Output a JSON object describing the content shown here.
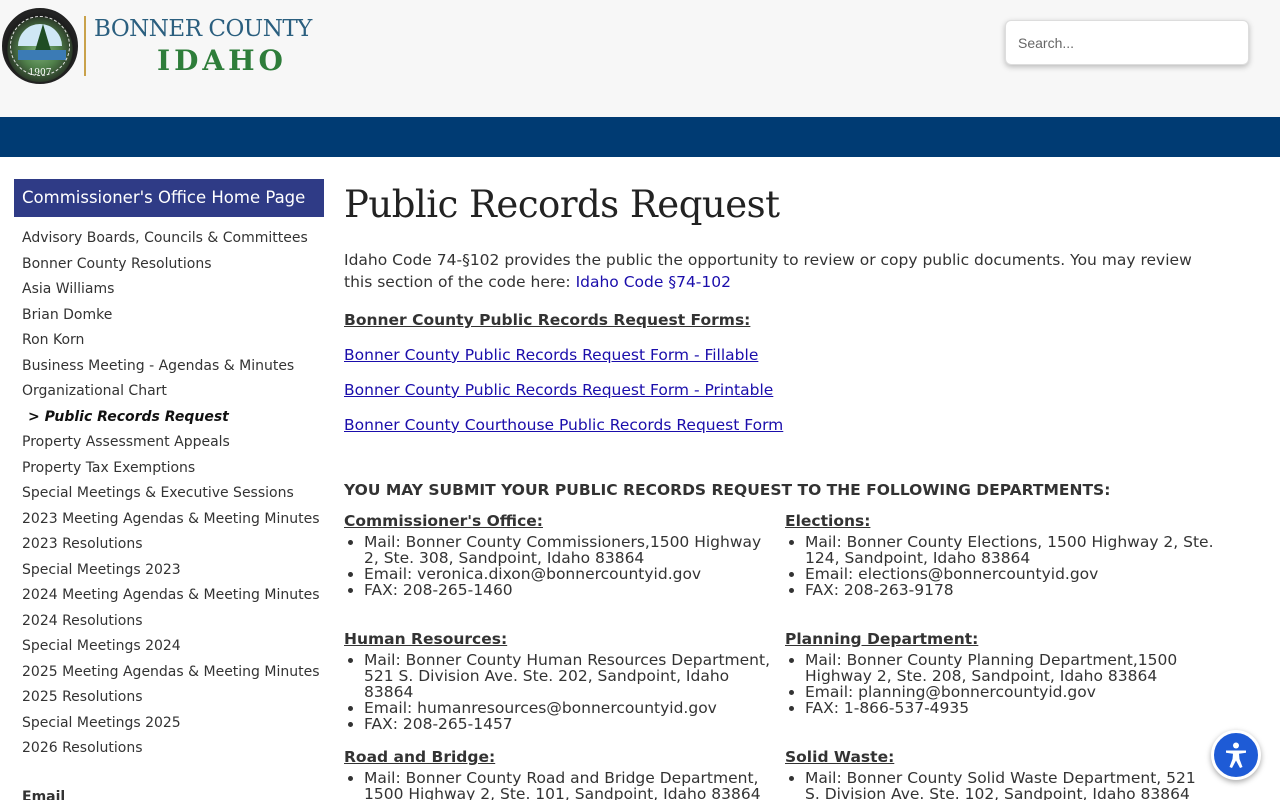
{
  "header": {
    "logo_line1": "BONNER COUNTY",
    "logo_line2": "IDAHO",
    "seal_year": "1907",
    "search_placeholder": "Search..."
  },
  "sidebar": {
    "home_label": "Commissioner's Office Home Page",
    "items": [
      {
        "label": "Advisory Boards, Councils & Committees"
      },
      {
        "label": "Bonner County Resolutions"
      },
      {
        "label": "Asia Williams"
      },
      {
        "label": "Brian Domke"
      },
      {
        "label": "Ron Korn"
      },
      {
        "label": "Business Meeting - Agendas & Minutes"
      },
      {
        "label": "Organizational Chart"
      },
      {
        "label": "> Public Records Request"
      },
      {
        "label": "Property Assessment Appeals"
      },
      {
        "label": "Property Tax Exemptions"
      },
      {
        "label": "Special Meetings & Executive Sessions"
      },
      {
        "label": "2023 Meeting Agendas & Meeting Minutes"
      },
      {
        "label": "2023 Resolutions"
      },
      {
        "label": "Special Meetings 2023"
      },
      {
        "label": "2024 Meeting Agendas & Meeting Minutes"
      },
      {
        "label": "2024 Resolutions"
      },
      {
        "label": "Special Meetings 2024"
      },
      {
        "label": "2025 Meeting Agendas & Meeting Minutes"
      },
      {
        "label": "2025 Resolutions"
      },
      {
        "label": "Special Meetings 2025"
      },
      {
        "label": "2026 Resolutions"
      }
    ],
    "email_heading": "Email"
  },
  "main": {
    "title": "Public Records Request",
    "intro_text": "Idaho Code 74-§102 provides the public the opportunity to review or copy public documents.  You may review this section of the code here:  ",
    "intro_link": "Idaho Code §74-102",
    "forms_heading": "Bonner County Public Records Request Forms:",
    "form_links": [
      "Bonner County Public Records Request Form - Fillable",
      "Bonner County Public Records Request Form - Printable",
      "Bonner County Courthouse Public Records Request Form"
    ],
    "departments_heading": "YOU MAY SUBMIT YOUR PUBLIC RECORDS REQUEST TO THE FOLLOWING DEPARTMENTS:",
    "departments": [
      {
        "name": "Commissioner's Office:",
        "mail": "Mail:  Bonner County Commissioners,1500 Highway 2, Ste. 308, Sandpoint, Idaho 83864",
        "email": "Email:  veronica.dixon@bonnercountyid.gov",
        "fax": "FAX:  208-265-1460"
      },
      {
        "name": "Elections:",
        "mail": "Mail:  Bonner County Elections, 1500 Highway 2, Ste. 124, Sandpoint, Idaho 83864",
        "email": "Email:  elections@bonnercountyid.gov",
        "fax": "FAX:  208-263-9178"
      },
      {
        "name": "Human Resources:",
        "mail": "Mail:  Bonner County Human Resources Department, 521 S. Division Ave. Ste. 202, Sandpoint, Idaho 83864",
        "email": "Email:  humanresources@bonnercountyid.gov",
        "fax": "FAX:  208-265-1457"
      },
      {
        "name": "Planning Department:",
        "mail": "Mail:  Bonner County Planning Department,1500 Highway 2, Ste. 208, Sandpoint, Idaho 83864",
        "email": "Email:  planning@bonnercountyid.gov",
        "fax": "FAX:  1-866-537-4935"
      },
      {
        "name": "Road and Bridge:",
        "mail": "Mail:  Bonner County Road and Bridge Department, 1500 Highway 2, Ste. 101, Sandpoint, Idaho 83864"
      },
      {
        "name": "Solid Waste:",
        "mail": "Mail:  Bonner County Solid Waste Department, 521 S. Division Ave. Ste. 102, Sandpoint, Idaho 83864"
      }
    ]
  },
  "colors": {
    "navbar": "#003b73",
    "sidebar_home_bg": "#2f3b86",
    "link": "#1a0dab",
    "accessibility_button": "#1e5bd6"
  },
  "icons": {
    "accessibility": "accessibility-icon",
    "seal": "county-seal-icon"
  }
}
